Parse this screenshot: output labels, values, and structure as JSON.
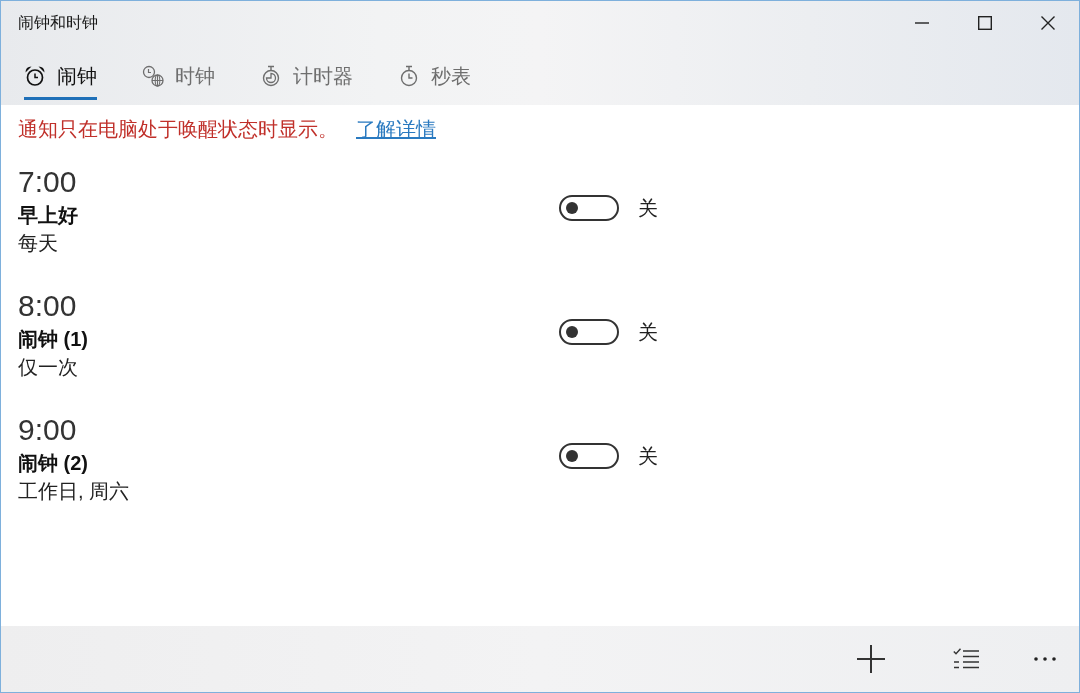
{
  "window": {
    "title": "闹钟和时钟"
  },
  "tabs": [
    {
      "kind": "alarm",
      "label": "闹钟",
      "selected": true
    },
    {
      "kind": "world-clock",
      "label": "时钟",
      "selected": false
    },
    {
      "kind": "timer",
      "label": "计时器",
      "selected": false
    },
    {
      "kind": "stopwatch",
      "label": "秒表",
      "selected": false
    }
  ],
  "notice": {
    "text": "通知只在电脑处于唤醒状态时显示。",
    "link": "了解详情"
  },
  "alarms": [
    {
      "time": "7:00",
      "name": "早上好",
      "repeat": "每天",
      "on": false,
      "state_label": "关"
    },
    {
      "time": "8:00",
      "name": "闹钟 (1)",
      "repeat": "仅一次",
      "on": false,
      "state_label": "关"
    },
    {
      "time": "9:00",
      "name": "闹钟 (2)",
      "repeat": "工作日, 周六",
      "on": false,
      "state_label": "关"
    }
  ]
}
